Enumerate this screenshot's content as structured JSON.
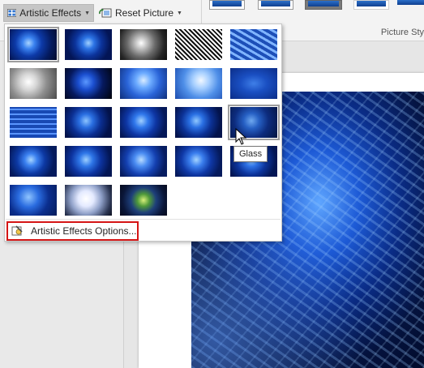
{
  "ribbon": {
    "artistic_effects_label": "Artistic Effects",
    "reset_picture_label": "Reset Picture",
    "picture_styles_group_label": "Picture Sty"
  },
  "gallery": {
    "items": [
      {
        "style": "radial-gradient(circle at 40% 45%, #a8d4ff 0%, #3a82f0 18%, #0d3aa8 40%, #041a5e 70%, #020a2a 100%)",
        "selected": true
      },
      {
        "style": "radial-gradient(circle at 50% 45%, #9fd0ff 0%, #2c74e6 20%, #0c349c 45%, #031556 75%)"
      },
      {
        "style": "radial-gradient(circle at 45% 45%, #ffffff 0%, #bdbdbd 20%, #6a6a6a 45%, #242424 75%, #0c0c0c 100%)"
      },
      {
        "style": "repeating-linear-gradient(45deg, #ffffff 0 2px, #111111 2px 4px)"
      },
      {
        "style": "repeating-linear-gradient(30deg, #7fb4ff 0 3px, #1d4fb8 3px 7px)"
      },
      {
        "style": "radial-gradient(circle at 40% 45%, #ffffff 0%, #d5d5d5 25%, #8e8e8e 55%, #4a4a4a 100%)"
      },
      {
        "style": "radial-gradient(circle at 45% 45%, #5b98ff 0%, #1b4fd0 25%, #06195e 55%, #000309 100%)"
      },
      {
        "style": "radial-gradient(circle at 50% 40%, #d9ecff 0%, #6cabff 25%, #2a64d8 55%, #0f2f7a 100%)"
      },
      {
        "style": "radial-gradient(circle at 55% 40%, #f2f8ff 0%, #a8d0ff 25%, #4f8fe8 55%, #1c4db0 100%)"
      },
      {
        "style": "radial-gradient(ellipse at 50% 50%, #3f7fe8 0%, #1a4fc2 40%, #0b2d88 100%)"
      },
      {
        "style": "repeating-linear-gradient(0deg, #1849b4 0 4px, #5a95ff 4px 6px), #2b63d4"
      },
      {
        "style": "radial-gradient(circle at 45% 45%, #8cc4ff 0%, #2a6fe2 22%, #0b2f92 48%, #03124a 78%)"
      },
      {
        "style": "radial-gradient(circle at 45% 45%, #a0d0ff 0%, #3078ec 22%, #0e36a4 48%, #041858 78%)"
      },
      {
        "style": "radial-gradient(circle at 45% 45%, #90c8ff 0%, #2a70e4 22%, #0c3296 48%, #03134c 78%)"
      },
      {
        "style": "radial-gradient(circle at 45% 45%, #6fa9f0 0%, #2660c4 25%, #0d2c7e 55%, #041540 100%)",
        "hovered": true
      },
      {
        "style": "radial-gradient(circle at 45% 45%, #a8d6ff 0%, #3a80f0 20%, #0d39a4 45%, #041a5c 75%)"
      },
      {
        "style": "radial-gradient(circle at 45% 45%, #9ccfff 0%, #2e76e8 22%, #0d34a0 48%, #031654 78%)"
      },
      {
        "style": "radial-gradient(circle at 45% 45%, #b8dcff 0%, #4a8cf2 22%, #1440b0 48%, #061c60 78%)"
      },
      {
        "style": "radial-gradient(circle at 45% 45%, #a4d4ff 0%, #3a7eee 22%, #0f38a6 48%, #051a5c 78%)"
      },
      {
        "style": "radial-gradient(circle at 45% 45%, #94caff 0%, #2e72e6 22%, #0c349c 48%, #031654 78%)"
      },
      {
        "style": "radial-gradient(circle at 40% 40%, #8fc4ff 0%, #2a6ce0 30%, #0b2e8e 60%, #041c5a 100%)"
      },
      {
        "style": "radial-gradient(circle at 45% 45%, #ffffff 0%, #e4eaff 25%, #8fa0c8 50%, #2b3552 80%, #0c1020 100%)"
      },
      {
        "style": "radial-gradient(circle at 50% 50%, #d8f07a 0%, #4f9a3a 22%, #1e3f7a 45%, #0a1638 75%, #050a1c 100%)"
      }
    ]
  },
  "options_label": "Artistic Effects Options...",
  "tooltip_text": "Glass"
}
